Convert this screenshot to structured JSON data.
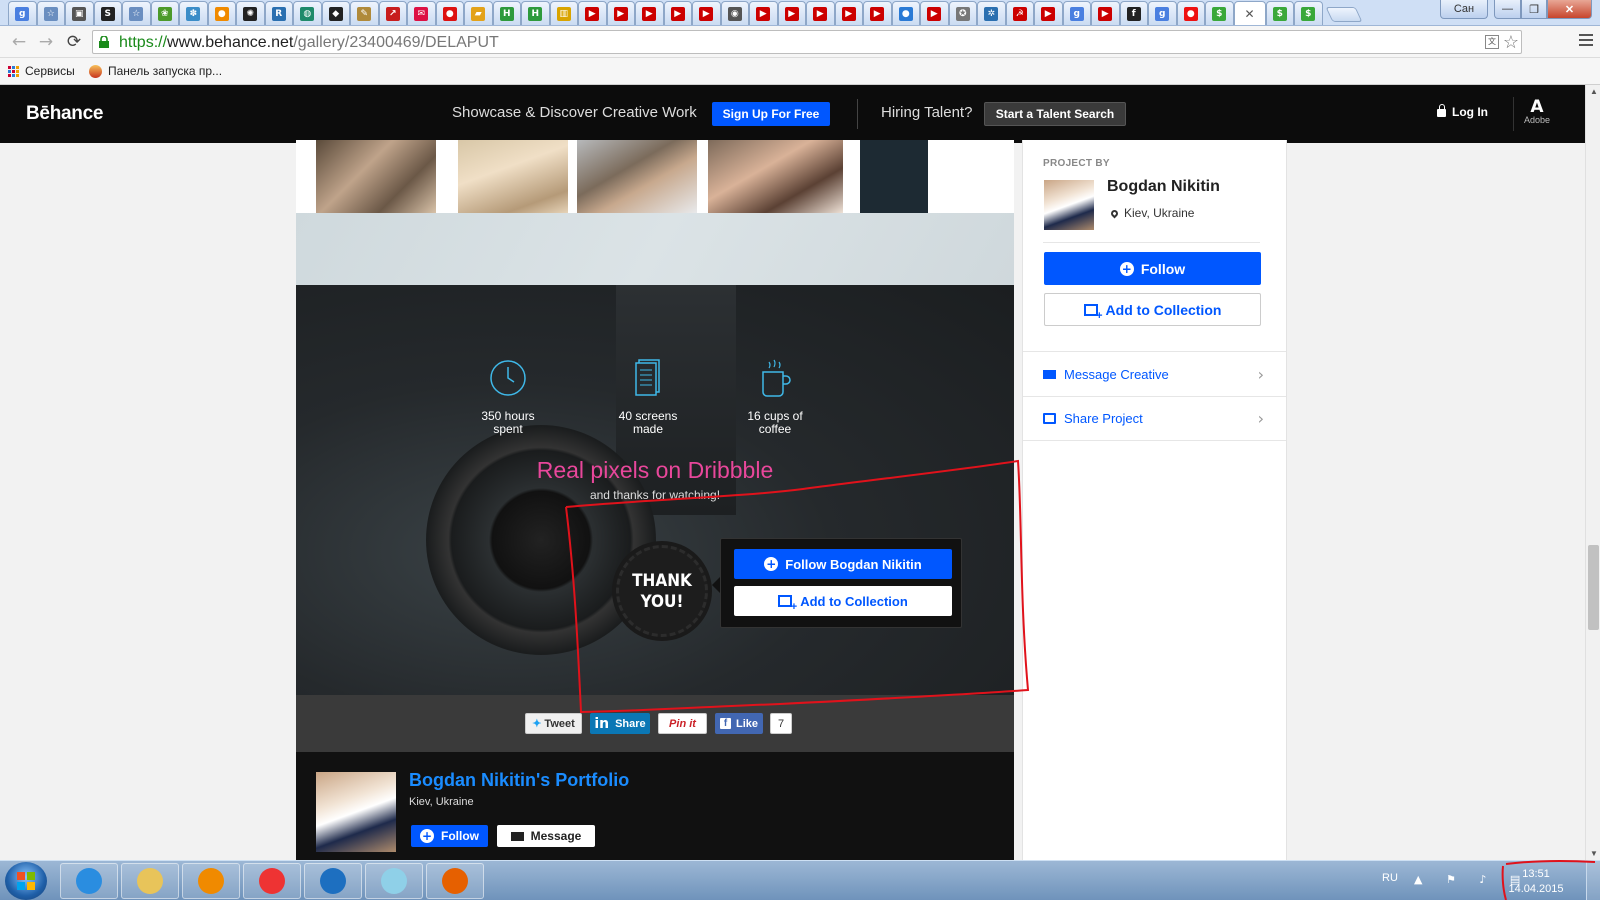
{
  "browser": {
    "tab_favicons": [
      {
        "icon": "google-icon",
        "letter": "g",
        "color": "#4a7fe0"
      },
      {
        "icon": "star-bookmark-icon",
        "letter": "☆",
        "color": "#6a8ec0"
      },
      {
        "icon": "car-icon",
        "letter": "▣",
        "color": "#555"
      },
      {
        "icon": "s-icon",
        "letter": "S",
        "color": "#222"
      },
      {
        "icon": "star-bookmark-icon",
        "letter": "☆",
        "color": "#6a8ec0"
      },
      {
        "icon": "green-leaf-icon",
        "letter": "❀",
        "color": "#4c9a2a"
      },
      {
        "icon": "flower-icon",
        "letter": "✽",
        "color": "#3b8dc8"
      },
      {
        "icon": "orange-icon",
        "letter": "●",
        "color": "#f08a00"
      },
      {
        "icon": "film-reel-icon",
        "letter": "✺",
        "color": "#222"
      },
      {
        "icon": "r-icon",
        "letter": "R",
        "color": "#2a6fb0"
      },
      {
        "icon": "globe-icon",
        "letter": "◍",
        "color": "#1f8a6a"
      },
      {
        "icon": "drop-icon",
        "letter": "◆",
        "color": "#222"
      },
      {
        "icon": "pencil-icon",
        "letter": "✎",
        "color": "#b08a3a"
      },
      {
        "icon": "arrow-red-icon",
        "letter": "↗",
        "color": "#c81d1d"
      },
      {
        "icon": "mail-red-icon",
        "letter": "✉",
        "color": "#d14"
      },
      {
        "icon": "red-circle-icon",
        "letter": "●",
        "color": "#d11"
      },
      {
        "icon": "ticket-icon",
        "letter": "▰",
        "color": "#e3a21a"
      },
      {
        "icon": "h-icon",
        "letter": "H",
        "color": "#2e9a3c"
      },
      {
        "icon": "h-icon",
        "letter": "H",
        "color": "#2e9a3c"
      },
      {
        "icon": "chart-icon",
        "letter": "▥",
        "color": "#d9a400"
      },
      {
        "icon": "youtube-icon",
        "letter": "▶",
        "color": "#c00"
      },
      {
        "icon": "youtube-icon",
        "letter": "▶",
        "color": "#c00"
      },
      {
        "icon": "youtube-icon",
        "letter": "▶",
        "color": "#c00"
      },
      {
        "icon": "youtube-icon",
        "letter": "▶",
        "color": "#c00"
      },
      {
        "icon": "youtube-icon",
        "letter": "▶",
        "color": "#c00"
      },
      {
        "icon": "owl-icon",
        "letter": "◉",
        "color": "#555"
      },
      {
        "icon": "youtube-icon",
        "letter": "▶",
        "color": "#c00"
      },
      {
        "icon": "youtube-icon",
        "letter": "▶",
        "color": "#c00"
      },
      {
        "icon": "youtube-icon",
        "letter": "▶",
        "color": "#c00"
      },
      {
        "icon": "youtube-icon",
        "letter": "▶",
        "color": "#c00"
      },
      {
        "icon": "youtube-icon",
        "letter": "▶",
        "color": "#c00"
      },
      {
        "icon": "pin-blue-icon",
        "letter": "●",
        "color": "#2a7ad5"
      },
      {
        "icon": "youtube-icon",
        "letter": "▶",
        "color": "#c00"
      },
      {
        "icon": "soccer-icon",
        "letter": "✪",
        "color": "#777"
      },
      {
        "icon": "gear-icon",
        "letter": "✲",
        "color": "#2a6fb0"
      },
      {
        "icon": "ussr-icon",
        "letter": "☭",
        "color": "#c00"
      },
      {
        "icon": "youtube-icon",
        "letter": "▶",
        "color": "#c00"
      },
      {
        "icon": "google-icon",
        "letter": "g",
        "color": "#4a7fe0"
      },
      {
        "icon": "youtube-icon",
        "letter": "▶",
        "color": "#c00"
      },
      {
        "icon": "f-icon",
        "letter": "f",
        "color": "#222"
      },
      {
        "icon": "google-icon",
        "letter": "g",
        "color": "#4a7fe0"
      },
      {
        "icon": "red-ball-icon",
        "letter": "●",
        "color": "#e11"
      },
      {
        "icon": "dollar-icon",
        "letter": "$",
        "color": "#3aa83a"
      },
      {
        "icon": "dollar-icon",
        "letter": "$",
        "color": "#3aa83a"
      },
      {
        "icon": "dollar-icon",
        "letter": "$",
        "color": "#3aa83a"
      }
    ],
    "active_tab_close": "✕",
    "window_user": "Сан",
    "window_min": "—",
    "window_max": "❐",
    "window_close": "✕",
    "back": "←",
    "forward": "→",
    "reload": "⟳",
    "url_scheme": "https://",
    "url_host": "www.behance.net",
    "url_path": "/gallery/23400469/DELAPUT",
    "star": "☆",
    "bookmarks": {
      "apps_label": "Сервисы",
      "launch_label": "Панель запуска пр..."
    }
  },
  "behance": {
    "logo": "Bēhance",
    "tagline": "Showcase & Discover Creative Work",
    "signup": "Sign Up For Free",
    "hiring": "Hiring Talent?",
    "talent_search": "Start a Talent Search",
    "login": "Log In",
    "adobe_mark": "A",
    "adobe_label": "Adobe"
  },
  "project": {
    "stats": [
      {
        "icon": "clock-icon",
        "line1": "350 hours",
        "line2": "spent"
      },
      {
        "icon": "screens-icon",
        "line1": "40 screens",
        "line2": "made"
      },
      {
        "icon": "coffee-cup-icon",
        "line1": "16 cups of",
        "line2": "coffee"
      }
    ],
    "real_pixels": "Real pixels on Dribbble",
    "thanks": "and thanks for watching!",
    "badge_line1": "THANK",
    "badge_line2": "YOU!",
    "cta_follow": "Follow Bogdan Nikitin",
    "cta_collect": "Add to Collection",
    "share": {
      "tweet": "Tweet",
      "linkedin": "Share",
      "pinterest": "Pin it",
      "facebook": "Like",
      "fb_count": "7"
    },
    "owner": {
      "portfolio_title": "Bogdan Nikitin's Portfolio",
      "location": "Kiev, Ukraine",
      "follow": "Follow",
      "message": "Message"
    }
  },
  "sidebar": {
    "project_by": "PROJECT BY",
    "name": "Bogdan Nikitin",
    "location": "Kiev, Ukraine",
    "follow": "Follow",
    "add_collection": "Add to Collection",
    "message_creative": "Message Creative",
    "share_project": "Share Project",
    "chevron": "›"
  },
  "taskbar": {
    "apps": [
      {
        "icon": "internet-explorer-icon",
        "color": "#2a8de0"
      },
      {
        "icon": "file-explorer-icon",
        "color": "#e8c45a"
      },
      {
        "icon": "media-player-icon",
        "color": "#f08a00"
      },
      {
        "icon": "chrome-icon",
        "color": "#e33"
      },
      {
        "icon": "maxthon-icon",
        "color": "#1d6fc0"
      },
      {
        "icon": "notepad-icon",
        "color": "#8fd0e8"
      },
      {
        "icon": "firefox-icon",
        "color": "#e66000"
      }
    ],
    "lang": "RU",
    "tray": "▲ ⚑ ♪ ▤",
    "time": "13:51",
    "date": "14.04.2015"
  },
  "colors": {
    "behance_blue": "#0057ff",
    "annotation_red": "#e0121b",
    "pink_headline": "#e8479b"
  }
}
